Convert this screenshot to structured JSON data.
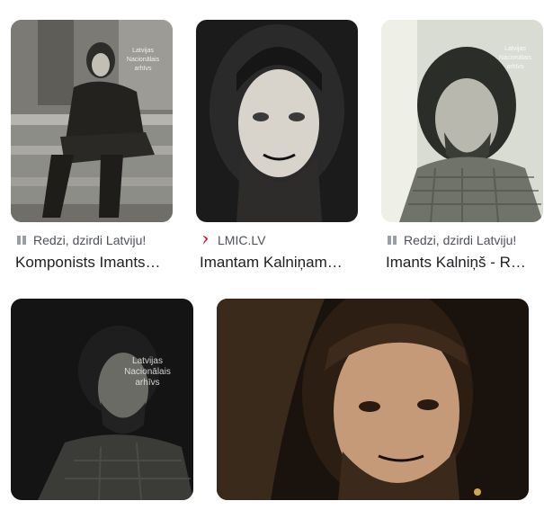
{
  "results": [
    {
      "source": "Redzi, dzirdi Latviju!",
      "source_icon": "book-icon",
      "title": "Komponists Imants…",
      "watermark": "Latvijas Nacionālais arhīvs"
    },
    {
      "source": "LMIC.LV",
      "source_icon": "lmic-logo-icon",
      "title": "Imantam Kalniņam…"
    },
    {
      "source": "Redzi, dzirdi Latviju!",
      "source_icon": "book-icon",
      "title": "Imants Kalniņš - R…",
      "watermark": "Latvijas Nacionālais arhīvs"
    },
    {
      "watermark": "Latvijas Nacionālais arhīvs"
    },
    {}
  ],
  "colors": {
    "title_text": "#202124",
    "source_text": "#4d5156",
    "lmic_logo": "#c8102e"
  }
}
